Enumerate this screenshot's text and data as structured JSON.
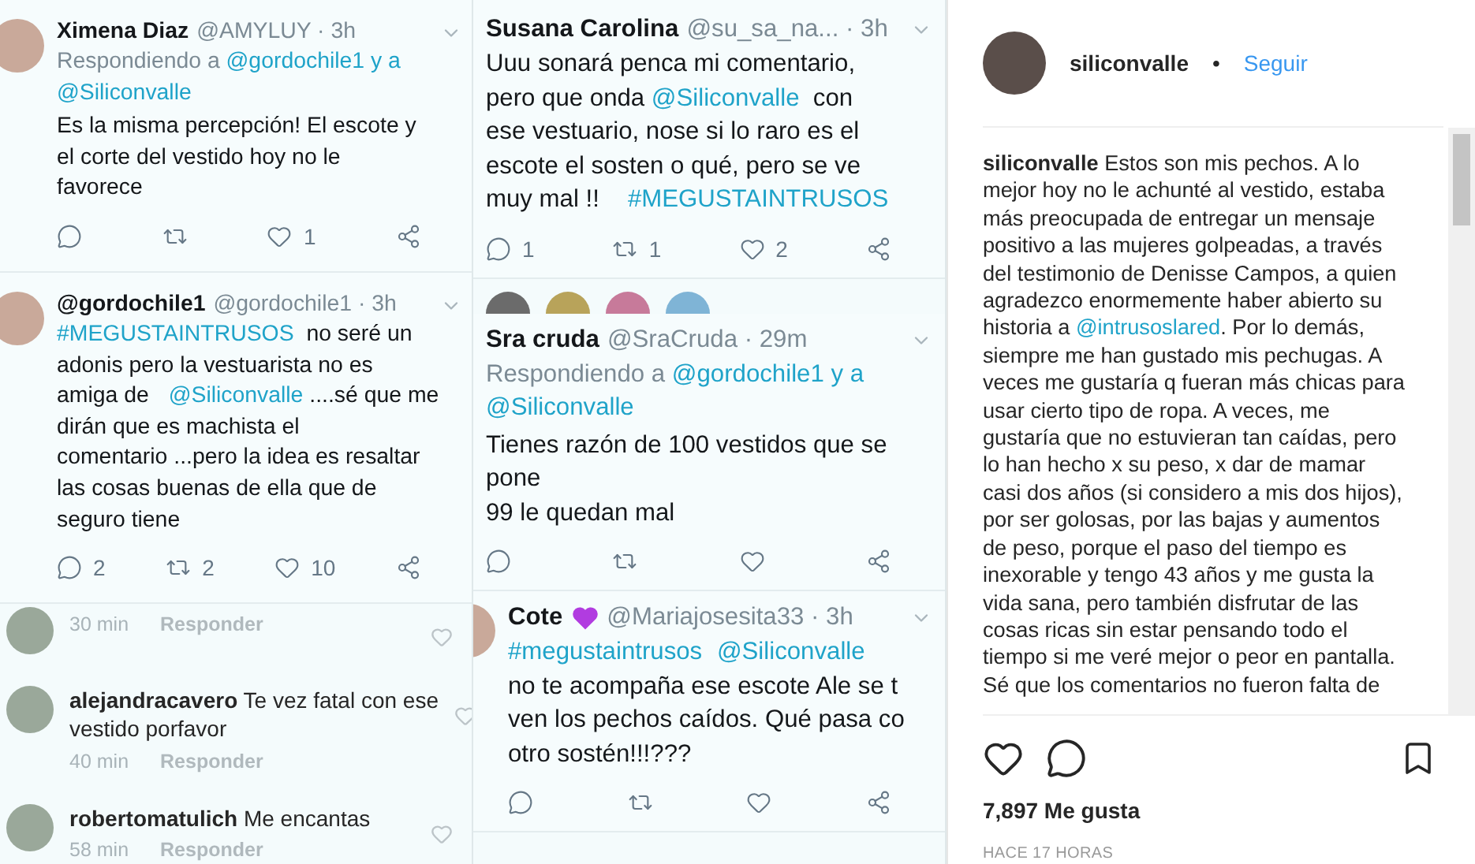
{
  "left_tweets": [
    {
      "name": "Ximena Diaz",
      "meta": "@AMYLUY · 3h",
      "reply": [
        {
          "kind": "plain",
          "text": "Respondiendo a "
        },
        {
          "kind": "link",
          "text": "@gordochile1 y a"
        },
        {
          "kind": "break"
        },
        {
          "kind": "link",
          "text": "@Siliconvalle"
        }
      ],
      "body": [
        {
          "kind": "plain",
          "text": "Es la misma percepción! El escote y\nel corte del vestido hoy no le\nfavorece"
        }
      ],
      "actions": [
        {
          "kind": "reply"
        },
        {
          "kind": "retweet"
        },
        {
          "kind": "like",
          "count": "1"
        },
        {
          "kind": "share"
        }
      ]
    },
    {
      "name": "@gordochile1",
      "meta": "@gordochile1 · 3h",
      "body": [
        {
          "kind": "link",
          "text": "#MEGUSTAINTRUSOS"
        },
        {
          "kind": "plain",
          "text": "  no seré un\nadonis pero la vestuarista no es\namiga de "
        },
        {
          "kind": "link",
          "text": "@Siliconvalle"
        },
        {
          "kind": "plain",
          "text": " ....sé que me\ndirán que es machista el\ncomentario ...pero la idea es resaltar\nlas cosas buenas de ella que de\nseguro tiene"
        }
      ],
      "actions": [
        {
          "kind": "reply",
          "count": "2"
        },
        {
          "kind": "retweet",
          "count": "2"
        },
        {
          "kind": "like",
          "count": "10"
        },
        {
          "kind": "share"
        }
      ]
    }
  ],
  "comments": [
    {
      "time": "30 min",
      "reply_label": "Responder"
    },
    {
      "user": "alejandracavero",
      "text": "Te vez fatal con ese\nvestido porfavor",
      "time": "40 min",
      "reply_label": "Responder"
    },
    {
      "user": "robertomatulich",
      "text": "Me encantas",
      "time": "58 min",
      "reply_label": "Responder"
    }
  ],
  "middle_tweets": [
    {
      "name": "Susana Carolina",
      "meta": "@su_sa_na... · 3h",
      "body": [
        {
          "kind": "plain",
          "text": "Uuu sonará penca mi comentario,\npero que onda "
        },
        {
          "kind": "link",
          "text": "@Siliconvalle"
        },
        {
          "kind": "plain",
          "text": "  con\nese vestuario, nose si lo raro es el\nescote el sosten o qué, pero se ve\nmuy mal !!  "
        },
        {
          "kind": "link",
          "text": "#MEGUSTAINTRUSOS"
        }
      ],
      "actions": [
        {
          "kind": "reply",
          "count": "1"
        },
        {
          "kind": "retweet",
          "count": "1"
        },
        {
          "kind": "like",
          "count": "2"
        },
        {
          "kind": "share"
        }
      ]
    },
    {
      "name": "Sra cruda",
      "meta": "@SraCruda · 29m",
      "reply": [
        {
          "kind": "plain",
          "text": "Respondiendo a "
        },
        {
          "kind": "link",
          "text": "@gordochile1 y a"
        },
        {
          "kind": "break"
        },
        {
          "kind": "link",
          "text": "@Siliconvalle"
        }
      ],
      "body": [
        {
          "kind": "plain",
          "text": "Tienes razón de 100 vestidos que se\npone\n99 le quedan mal"
        }
      ],
      "actions": [
        {
          "kind": "reply"
        },
        {
          "kind": "retweet"
        },
        {
          "kind": "like"
        },
        {
          "kind": "share"
        }
      ]
    },
    {
      "name": "Cote",
      "meta": "@Mariajosesita33 · 3h",
      "body": [
        {
          "kind": "link",
          "text": "#megustaintrusos"
        },
        {
          "kind": "link",
          "text": "@Siliconvalle"
        },
        {
          "kind": "break"
        },
        {
          "kind": "plain",
          "text": "no te acompaña ese escote Ale se t\nven los pechos caídos. Qué pasa co\notro sostén!!!???"
        }
      ],
      "actions": [
        {
          "kind": "reply"
        },
        {
          "kind": "retweet"
        },
        {
          "kind": "like"
        },
        {
          "kind": "share"
        }
      ]
    }
  ],
  "post": {
    "user": "siliconvalle",
    "separator": "•",
    "follow": "Seguir",
    "caption": [
      {
        "kind": "bold",
        "text": "siliconvalle"
      },
      {
        "kind": "plain",
        "text": " Estos son mis pechos. A lo\nmejor hoy no le achunté al vestido, estaba\nmás preocupada de entregar un mensaje\npositivo a las mujeres golpeadas, a través\ndel testimonio de Denisse Campos, a quien\nagradezco enormemente haber abierto su\nhistoria a "
      },
      {
        "kind": "link",
        "text": "@intrusoslared"
      },
      {
        "kind": "plain",
        "text": ". Por lo demás,\nsiempre me han gustado mis pechugas. A\nveces me gustaría q fueran más chicas para\nusar cierto tipo de ropa. A veces, me\ngustaría que no estuvieran tan caídas, pero\nlo han hecho x su peso, x dar de mamar\ncasi dos años (si considero a mis dos hijos),\npor ser golosas, por las bajas y aumentos\nde peso, porque el paso del tiempo es\ninexorable y tengo 43 años y me gusta la\nvida sana, pero también disfrutar de las\ncosas ricas sin estar pensando todo el\ntiempo si me veré mejor o peor en pantalla.\nSé que los comentarios no fueron falta de"
      }
    ],
    "likes": "7,897 Me gusta",
    "time": "HACE 17 HORAS"
  }
}
